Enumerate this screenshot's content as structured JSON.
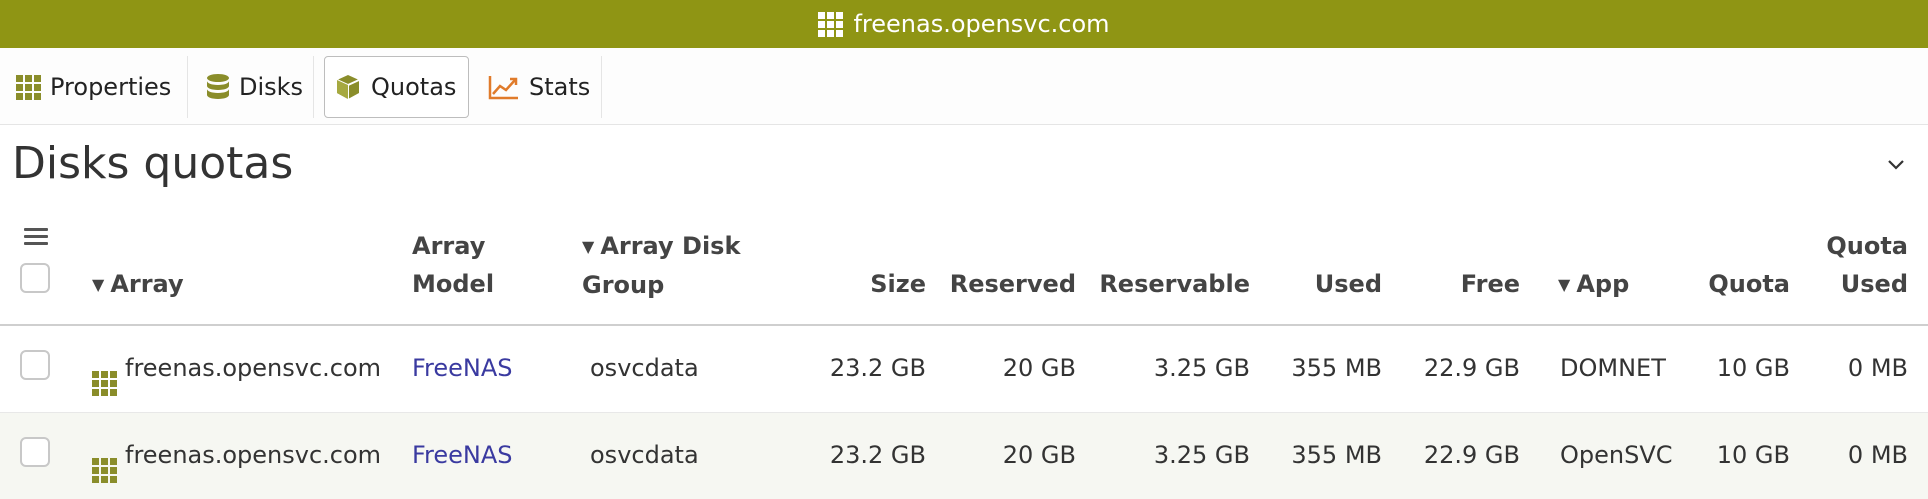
{
  "window": {
    "title": "freenas.opensvc.com"
  },
  "tabs": [
    {
      "label": "Properties",
      "icon": "grid-icon"
    },
    {
      "label": "Disks",
      "icon": "database-icon"
    },
    {
      "label": "Quotas",
      "icon": "cube-icon",
      "active": true
    },
    {
      "label": "Stats",
      "icon": "chart-line-icon"
    }
  ],
  "section": {
    "title": "Disks quotas",
    "collapse_icon": "chevron-down-icon"
  },
  "table": {
    "columns": {
      "array": "Array",
      "array_model": "Array Model",
      "array_disk_group": "Array Disk Group",
      "size": "Size",
      "reserved": "Reserved",
      "reservable": "Reservable",
      "used": "Used",
      "free": "Free",
      "app": "App",
      "quota": "Quota",
      "quota_used": "Quota Used"
    },
    "rows": [
      {
        "array": "freenas.opensvc.com",
        "array_model": "FreeNAS",
        "array_disk_group": "osvcdata",
        "size": "23.2 GB",
        "reserved": "20 GB",
        "reservable": "3.25 GB",
        "used": "355 MB",
        "free": "22.9 GB",
        "app": "DOMNET",
        "quota": "10 GB",
        "quota_used": "0 MB"
      },
      {
        "array": "freenas.opensvc.com",
        "array_model": "FreeNAS",
        "array_disk_group": "osvcdata",
        "size": "23.2 GB",
        "reserved": "20 GB",
        "reservable": "3.25 GB",
        "used": "355 MB",
        "free": "22.9 GB",
        "app": "OpenSVC",
        "quota": "10 GB",
        "quota_used": "0 MB"
      }
    ]
  },
  "colors": {
    "titlebar": "#8f9514",
    "icon_olive": "#8a8d2a",
    "link": "#3a3aa0",
    "stats_icon": "#e07b2b"
  }
}
